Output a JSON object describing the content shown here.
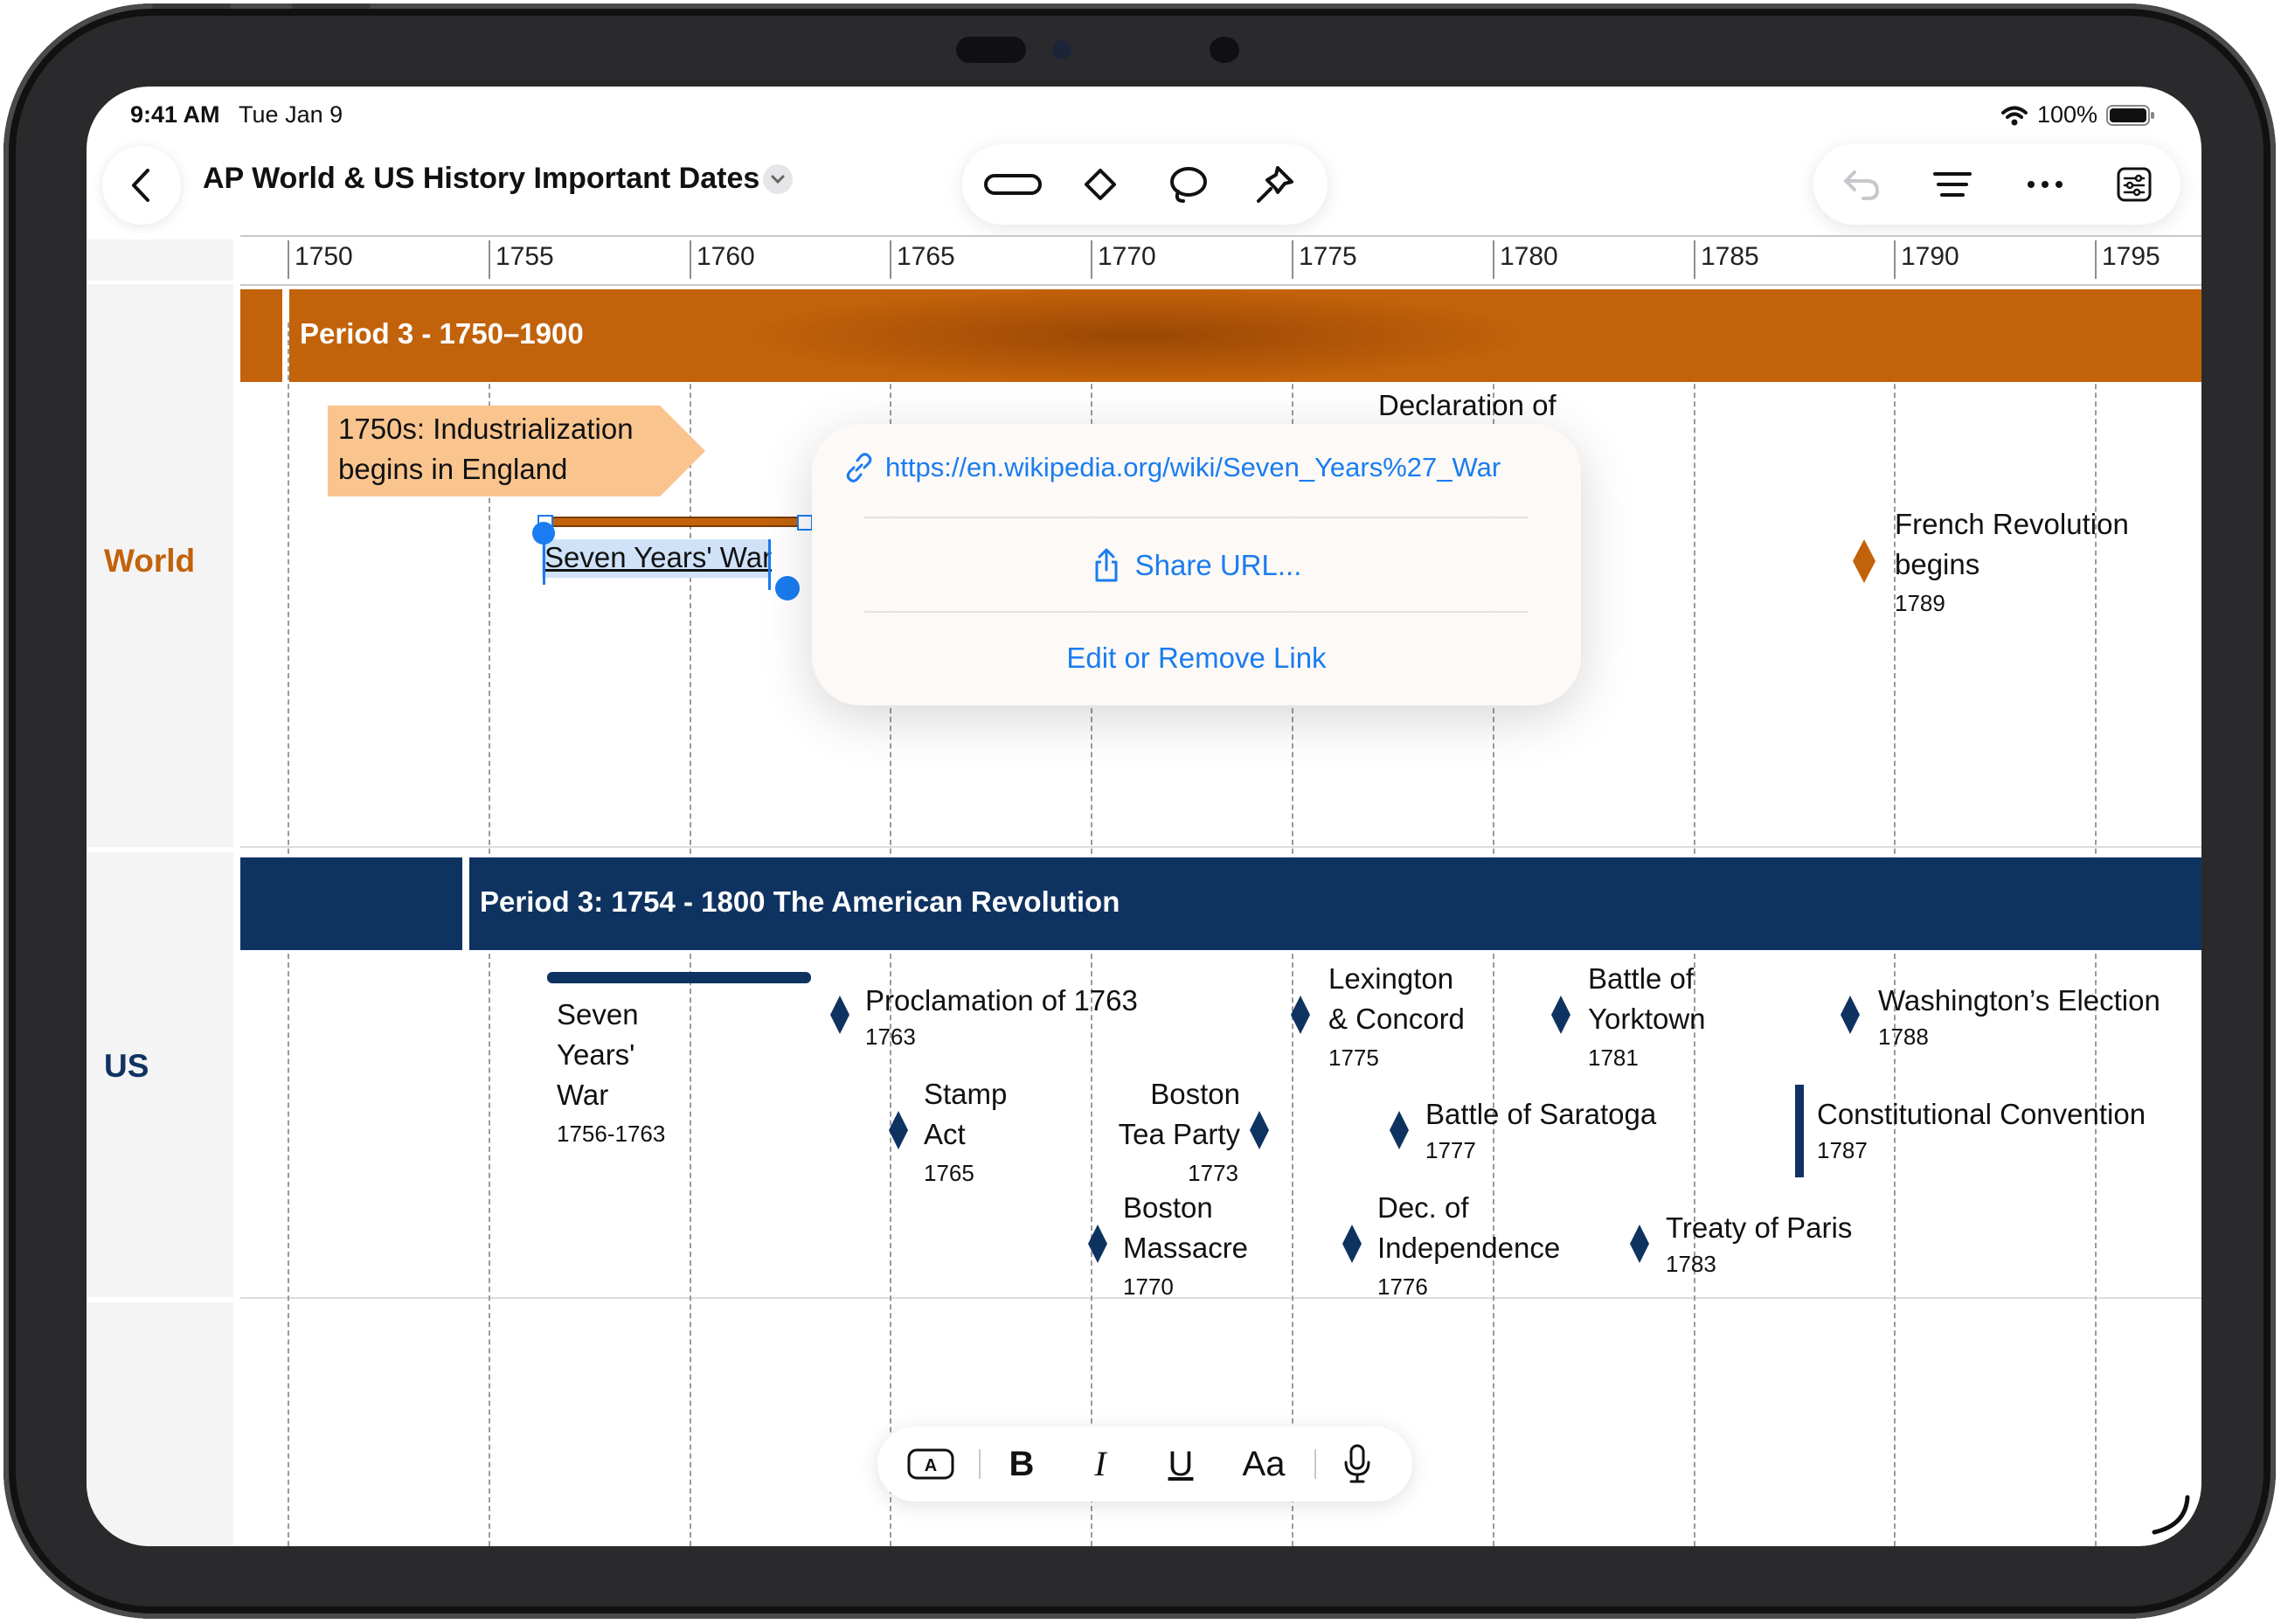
{
  "status": {
    "time": "9:41 AM",
    "date": "Tue Jan 9",
    "battery": "100%"
  },
  "header": {
    "title": "AP World & US History Important Dates",
    "icons": [
      "back-chevron-icon",
      "title-dropdown-icon",
      "pill-shape-icon",
      "diamond-shape-icon",
      "lasso-icon",
      "pin-tool-icon",
      "undo-icon",
      "list-lines-icon",
      "more-icon",
      "settings-panel-icon"
    ]
  },
  "ruler": {
    "years": [
      "1750",
      "1755",
      "1760",
      "1765",
      "1770",
      "1775",
      "1780",
      "1785",
      "1790",
      "1795"
    ]
  },
  "rows": {
    "world": "World",
    "us": "US"
  },
  "colors": {
    "orange": "#c2620a",
    "navy": "#0f3361",
    "link": "#1a7cf0"
  },
  "bands": {
    "world": "Period 3 - 1750–1900",
    "us": "Period 3: 1754 - 1800 The American Revolution"
  },
  "world_events": {
    "industrial": [
      "1750s: Industrialization",
      "begins in England"
    ],
    "seven_years": "Seven Years' War",
    "declaration": "Declaration of",
    "french": {
      "line1": "French Revolution",
      "line2": "begins",
      "year": "1789"
    }
  },
  "popup": {
    "url": "https://en.wikipedia.org/wiki/Seven_Years%27_War",
    "share": "Share URL...",
    "edit": "Edit or Remove Link"
  },
  "us_events": {
    "seven": {
      "l1": "Seven",
      "l2": "Years'",
      "l3": "War",
      "year": "1756-1763"
    },
    "proclamation": {
      "name": "Proclamation of 1763",
      "year": "1763"
    },
    "stamp": {
      "l1": "Stamp",
      "l2": "Act",
      "year": "1765"
    },
    "teaparty": {
      "l1": "Boston",
      "l2": "Tea Party",
      "year": "1773"
    },
    "massacre": {
      "l1": "Boston",
      "l2": "Massacre",
      "year": "1770"
    },
    "lexington": {
      "l1": "Lexington",
      "l2": "& Concord",
      "year": "1775"
    },
    "yorktown": {
      "l1": "Battle of",
      "l2": "Yorktown",
      "year": "1781"
    },
    "saratoga": {
      "name": "Battle of Saratoga",
      "year": "1777"
    },
    "independence": {
      "l1": "Dec. of",
      "l2": "Independence",
      "year": "1776"
    },
    "paris": {
      "name": "Treaty of Paris",
      "year": "1783"
    },
    "washington": {
      "name": "Washington’s Election",
      "year": "1788"
    },
    "constitution": {
      "name": "Constitutional Convention",
      "year": "1787"
    }
  },
  "format_bar": {
    "bold": "B",
    "italic": "I",
    "underline": "U",
    "size": "Aa",
    "icons": [
      "text-box-icon",
      "microphone-icon"
    ]
  }
}
